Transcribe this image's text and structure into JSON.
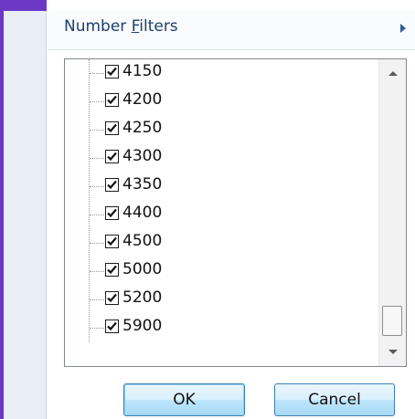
{
  "menu": {
    "number_filters_prefix": "Number ",
    "number_filters_accel": "F",
    "number_filters_suffix": "ilters"
  },
  "list": {
    "items": [
      {
        "label": "4150",
        "checked": true
      },
      {
        "label": "4200",
        "checked": true
      },
      {
        "label": "4250",
        "checked": true
      },
      {
        "label": "4300",
        "checked": true
      },
      {
        "label": "4350",
        "checked": true
      },
      {
        "label": "4400",
        "checked": true
      },
      {
        "label": "4500",
        "checked": true
      },
      {
        "label": "5000",
        "checked": true
      },
      {
        "label": "5200",
        "checked": true
      },
      {
        "label": "5900",
        "checked": true
      }
    ]
  },
  "buttons": {
    "ok_label": "OK",
    "cancel_label": "Cancel"
  },
  "colors": {
    "accent_purple": "#6a38c4",
    "menu_text": "#1c3f6e"
  }
}
